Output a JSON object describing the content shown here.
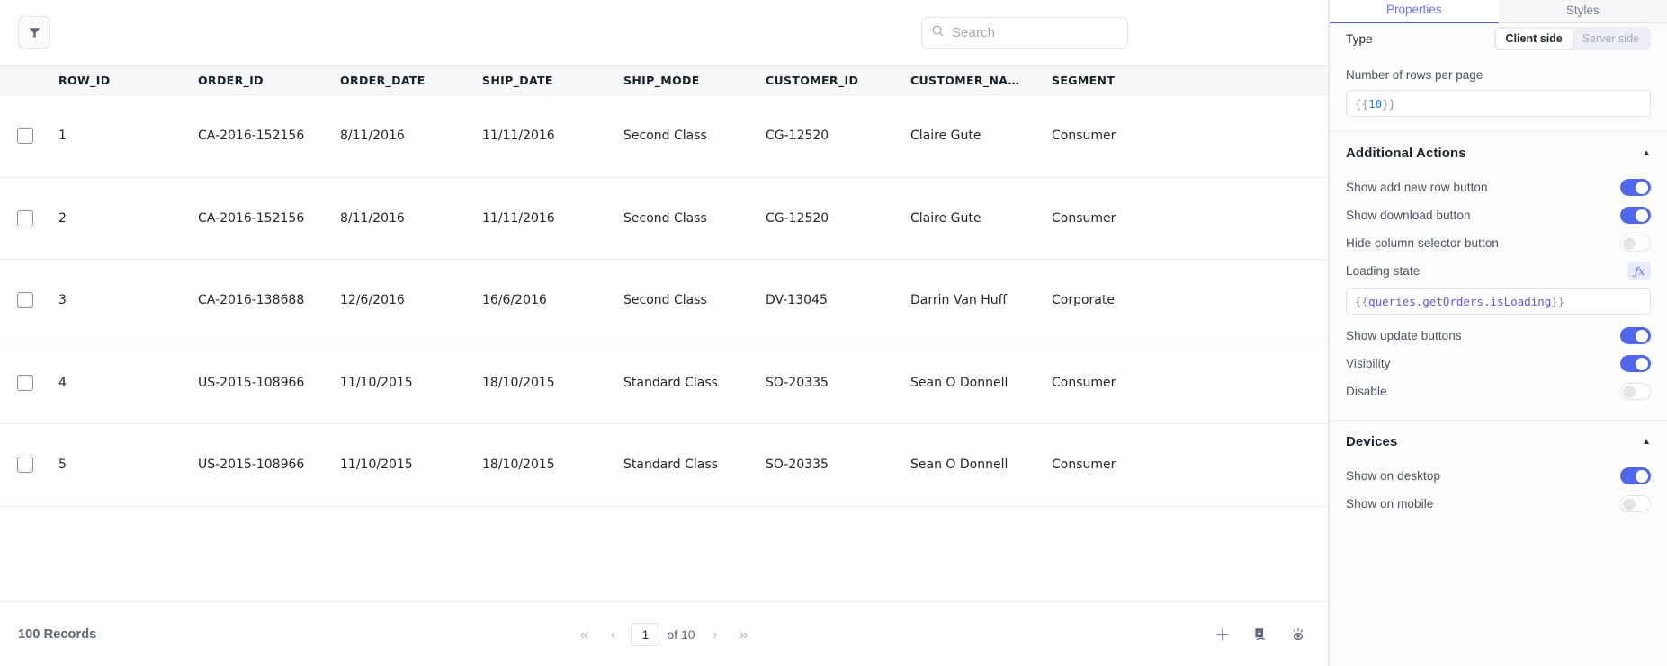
{
  "table": {
    "toolbar": {
      "filter_icon": "filter-icon",
      "search_icon": "search-icon",
      "search_value": "",
      "search_placeholder": "Search"
    },
    "columns": [
      "ROW_ID",
      "ORDER_ID",
      "ORDER_DATE",
      "SHIP_DATE",
      "SHIP_MODE",
      "CUSTOMER_ID",
      "CUSTOMER_NA…",
      "SEGMENT"
    ],
    "rows": [
      {
        "row_id": "1",
        "order_id": "CA-2016-152156",
        "order_date": "8/11/2016",
        "ship_date": "11/11/2016",
        "ship_mode": "Second Class",
        "customer_id": "CG-12520",
        "customer_name": "Claire Gute",
        "segment": "Consumer"
      },
      {
        "row_id": "2",
        "order_id": "CA-2016-152156",
        "order_date": "8/11/2016",
        "ship_date": "11/11/2016",
        "ship_mode": "Second Class",
        "customer_id": "CG-12520",
        "customer_name": "Claire Gute",
        "segment": "Consumer"
      },
      {
        "row_id": "3",
        "order_id": "CA-2016-138688",
        "order_date": "12/6/2016",
        "ship_date": "16/6/2016",
        "ship_mode": "Second Class",
        "customer_id": "DV-13045",
        "customer_name": "Darrin Van Huff",
        "segment": "Corporate"
      },
      {
        "row_id": "4",
        "order_id": "US-2015-108966",
        "order_date": "11/10/2015",
        "ship_date": "18/10/2015",
        "ship_mode": "Standard Class",
        "customer_id": "SO-20335",
        "customer_name": "Sean O Donnell",
        "segment": "Consumer"
      },
      {
        "row_id": "5",
        "order_id": "US-2015-108966",
        "order_date": "11/10/2015",
        "ship_date": "18/10/2015",
        "ship_mode": "Standard Class",
        "customer_id": "SO-20335",
        "customer_name": "Sean O Donnell",
        "segment": "Consumer"
      }
    ],
    "footer": {
      "records_label": "100 Records",
      "first_page_glyph": "«",
      "prev_page_glyph": "‹",
      "current_page": "1",
      "total_pages_label": "of 10",
      "next_page_glyph": "›",
      "last_page_glyph": "»",
      "actions": [
        {
          "name": "add-row-icon"
        },
        {
          "name": "download-icon"
        },
        {
          "name": "column-selector-icon"
        }
      ]
    }
  },
  "panel": {
    "tabs": [
      {
        "label": "Properties",
        "active": true
      },
      {
        "label": "Styles",
        "active": false
      }
    ],
    "type": {
      "label": "Type",
      "options": [
        {
          "label": "Client side",
          "selected": true
        },
        {
          "label": "Server side",
          "selected": false
        }
      ]
    },
    "rows_per_page": {
      "label": "Number of rows per page",
      "value": "{{10}}",
      "value_braces": "{{",
      "value_number": "10",
      "value_braces_close": "}}"
    },
    "additional_actions": {
      "title": "Additional Actions",
      "collapse_glyph": "▲",
      "items": [
        {
          "label": "Show add new row button",
          "toggle": "on"
        },
        {
          "label": "Show download button",
          "toggle": "on"
        },
        {
          "label": "Hide column selector button",
          "toggle": "off"
        }
      ],
      "loading_state": {
        "label": "Loading state",
        "fx_label": "ƒx",
        "value": "{{queries.getOrders.isLoading}}",
        "value_open": "{{",
        "value_path": "queries.getOrders.isLoading",
        "value_close": "}}"
      },
      "items_after": [
        {
          "label": "Show update buttons",
          "toggle": "on"
        },
        {
          "label": "Visibility",
          "toggle": "on"
        },
        {
          "label": "Disable",
          "toggle": "off"
        }
      ]
    },
    "devices": {
      "title": "Devices",
      "collapse_glyph": "▲",
      "items": [
        {
          "label": "Show on desktop",
          "toggle": "on"
        },
        {
          "label": "Show on mobile",
          "toggle": "off"
        }
      ]
    }
  },
  "colors": {
    "accent": "#4f5bf0",
    "toggle_on": "#4f67e8",
    "header_bg": "#f7f8fa",
    "code_text": "#6b52d6"
  }
}
